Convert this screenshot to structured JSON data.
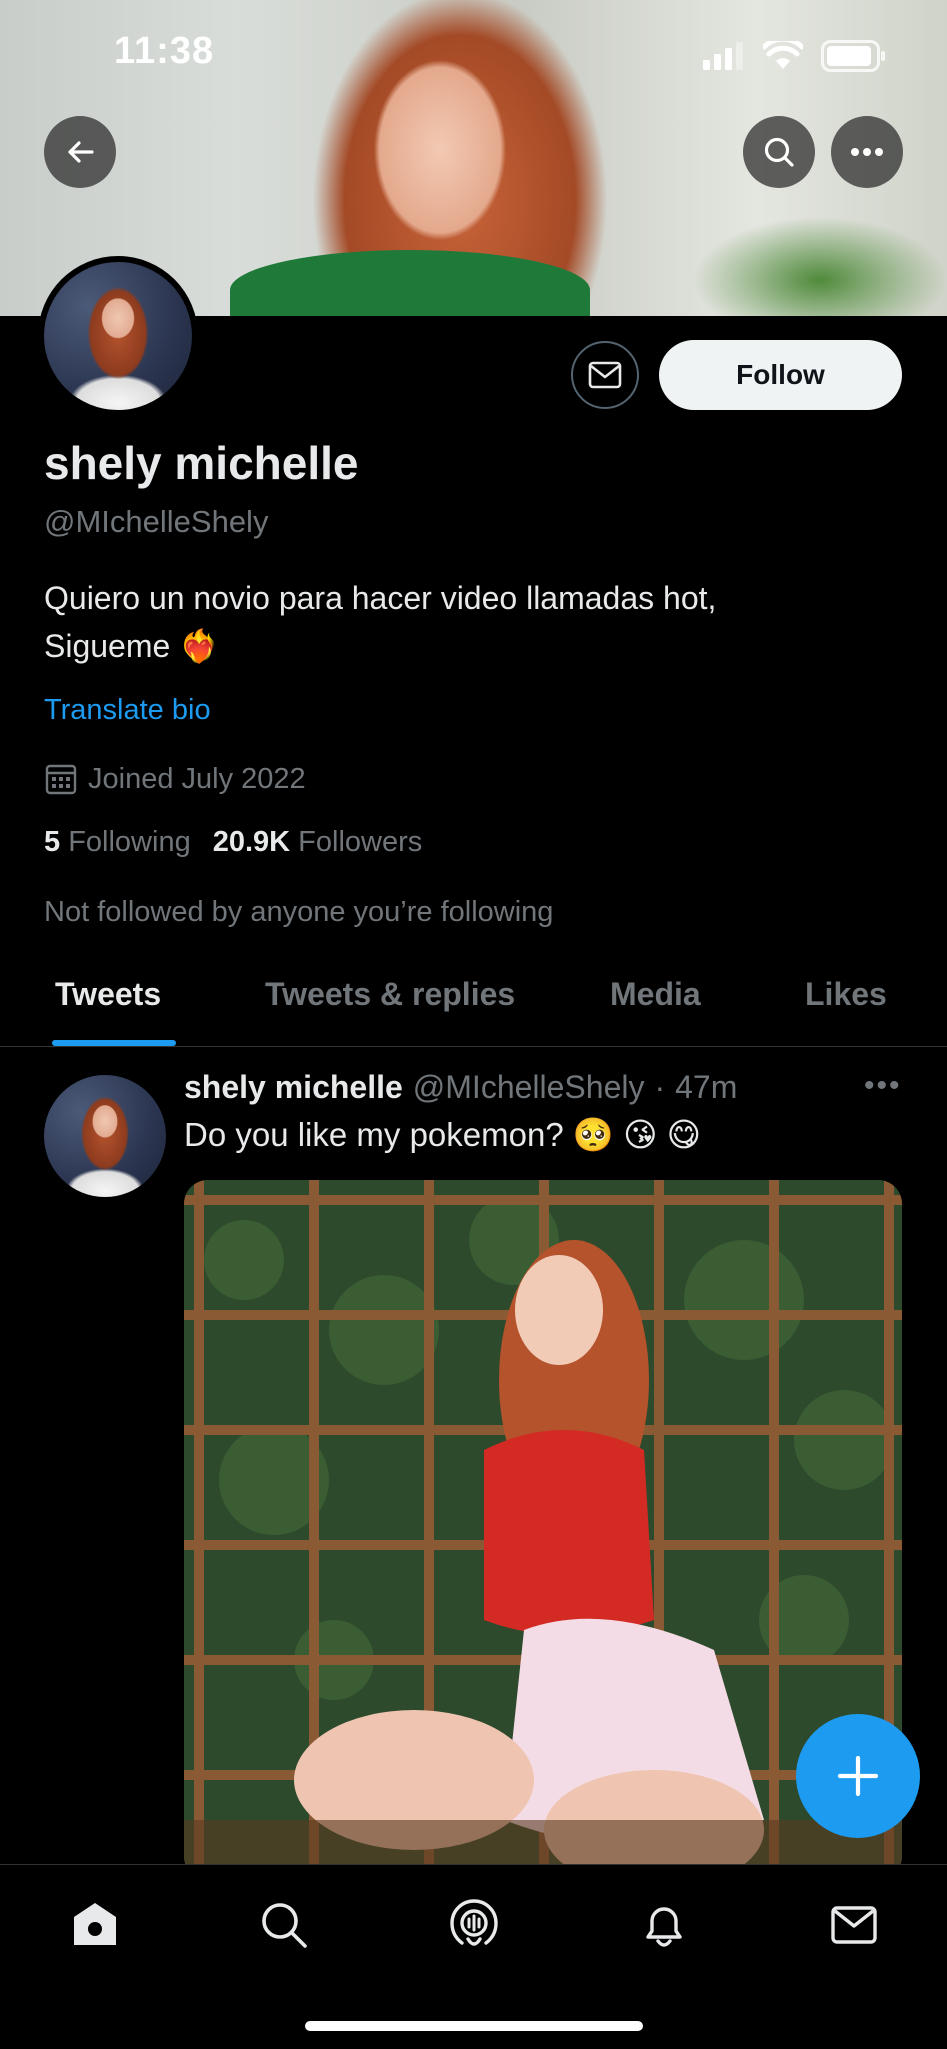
{
  "status_bar": {
    "time": "11:38"
  },
  "profile": {
    "name": "shely michelle",
    "handle": "@MIchelleShely",
    "bio_line1": "Quiero un novio para hacer video llamadas hot,",
    "bio_line2": "Sigueme ❤️‍🔥",
    "translate_label": "Translate bio",
    "joined": "Joined July 2022",
    "following_count": "5",
    "following_label": "Following",
    "followers_count": "20.9K",
    "followers_label": "Followers",
    "not_followed_text": "Not followed by anyone you’re following"
  },
  "actions": {
    "follow_label": "Follow"
  },
  "tabs": [
    {
      "label": "Tweets",
      "active": true
    },
    {
      "label": "Tweets & replies",
      "active": false
    },
    {
      "label": "Media",
      "active": false
    },
    {
      "label": "Likes",
      "active": false
    }
  ],
  "tweet": {
    "author_name": "shely michelle",
    "author_handle": "@MIchelleShely",
    "separator": "·",
    "time": "47m",
    "more": "•••",
    "text": "Do you like my pokemon? 🥺 😘 😋"
  },
  "colors": {
    "accent": "#1d9bf0",
    "background": "#000000",
    "muted": "#71767b"
  },
  "icons": [
    "back-arrow-icon",
    "search-icon",
    "more-icon",
    "mail-icon",
    "calendar-icon",
    "plus-icon",
    "home-icon",
    "explore-icon",
    "spaces-icon",
    "notifications-icon",
    "messages-icon"
  ]
}
